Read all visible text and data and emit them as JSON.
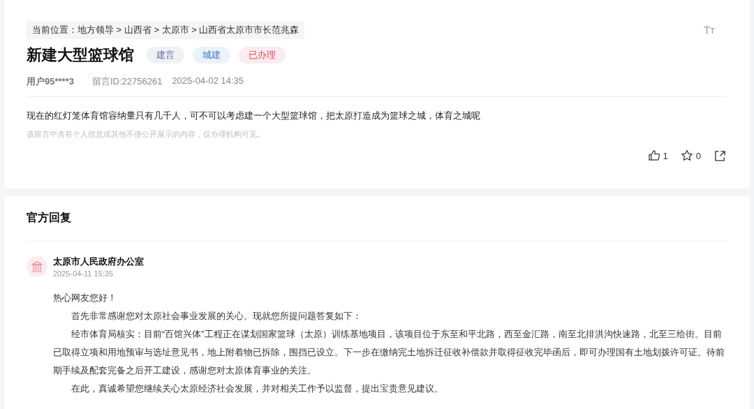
{
  "breadcrumb": "当前位置：地方领导 > 山西省 > 太原市 > 山西省太原市市长范兆森",
  "font_size_toggle": "Tт",
  "title": "新建大型篮球馆",
  "tags": [
    {
      "label": "建言",
      "color": "#5b6f9a"
    },
    {
      "label": "城建",
      "color": "#3d7bc6"
    },
    {
      "label": "已办理",
      "color": "#e0455a"
    }
  ],
  "meta": {
    "user": "用户95****3",
    "message_id": "留言ID:22756261",
    "time": "2025-04-02 14:35"
  },
  "content": "现在的红灯笼体育馆容纳量只有几千人，可不可以考虑建一个大型篮球馆，把太原打造成为篮球之城，体育之城呢",
  "privacy_note": "该留言中含有个人信息或其他不便公开展示的内容，仅办理机构可见。",
  "actions": [
    {
      "kind": "like",
      "count": "1"
    },
    {
      "kind": "favorite",
      "count": "0"
    },
    {
      "kind": "share"
    }
  ],
  "reply": {
    "heading": "官方回复",
    "office": "太原市人民政府办公室",
    "time": "2025-04-11 15:35",
    "paragraphs": [
      {
        "indent": false,
        "text": "热心网友您好！"
      },
      {
        "indent": true,
        "text": "首先非常感谢您对太原社会事业发展的关心。现就您所提问题答复如下："
      },
      {
        "indent": true,
        "text": "经市体育局核实：目前“百馆兴体”工程正在谋划国家篮球（太原）训练基地项目，该项目位于东至和平北路，西至金汇路，南至北排洪沟快速路，北至三给街。目前已取得立项和用地预审与选址意见书，地上附着物已拆除，围挡已设立。下一步在缴纳完土地拆迁征收补偿款并取得征收完毕函后，即可办理国有土地划拨许可证。待前期手续及配套完备之后开工建设，感谢您对太原体育事业的关注。"
      },
      {
        "indent": true,
        "text": "在此，真诚希望您继续关心太原经济社会发展，并对相关工作予以监督，提出宝贵意见建议。"
      }
    ]
  }
}
